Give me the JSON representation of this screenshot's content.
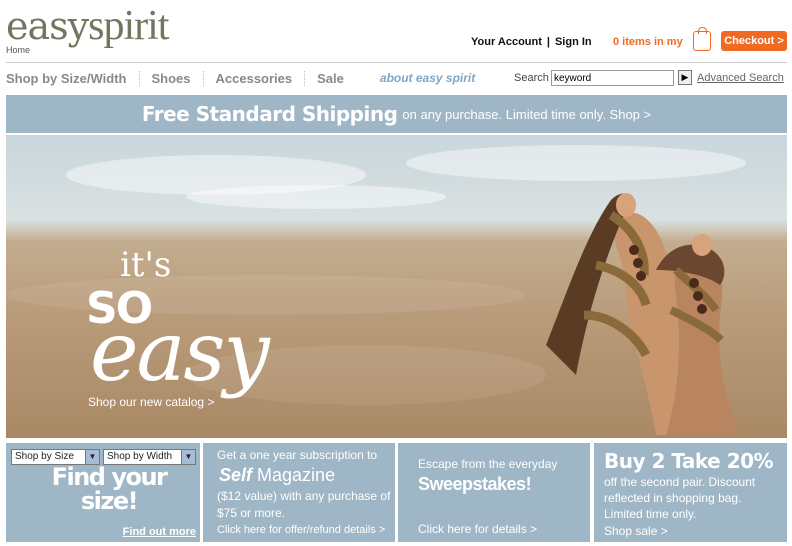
{
  "header": {
    "logo_easy": "easy",
    "logo_spirit": "spirit",
    "home_label": "Home",
    "your_account": "Your Account",
    "separator": "|",
    "sign_in": "Sign In",
    "cart_text": "0 items in my",
    "checkout_label": "Checkout >"
  },
  "nav": {
    "items": [
      "Shop by Size/Width",
      "Shoes",
      "Accessories",
      "Sale"
    ],
    "about": "about easy spirit"
  },
  "search": {
    "label": "Search",
    "value": "keyword",
    "go": "▶",
    "advanced": "Advanced Search"
  },
  "shipping": {
    "headline": "Free Standard Shipping",
    "detail": "on any purchase. Limited time only. Shop >"
  },
  "hero": {
    "its": "it's",
    "so": "SO",
    "easy": "easy",
    "link": "Shop our new catalog >"
  },
  "tiles": {
    "size": {
      "size_select": "Shop by Size",
      "width_select": "Shop by Width",
      "find": "Find your size!",
      "more": "Find out more"
    },
    "magazine": {
      "line1": "Get a one year subscription to",
      "self": "Self",
      "magazine": "Magazine",
      "line3": "($12 value) with any purchase of $75 or more.",
      "line5": "Click here for offer/refund details >"
    },
    "sweeps": {
      "line1": "Escape from the everyday",
      "headline": "Sweepstakes!",
      "link": "Click here for details >"
    },
    "promo": {
      "headline": "Buy 2 Take 20%",
      "body": "off the second pair. Discount reflected in shopping bag. Limited time only.",
      "link": "Shop sale >"
    }
  },
  "colors": {
    "accent_orange": "#f06a22",
    "banner_blue": "#9fb6c6",
    "logo_gray": "#75745f"
  }
}
